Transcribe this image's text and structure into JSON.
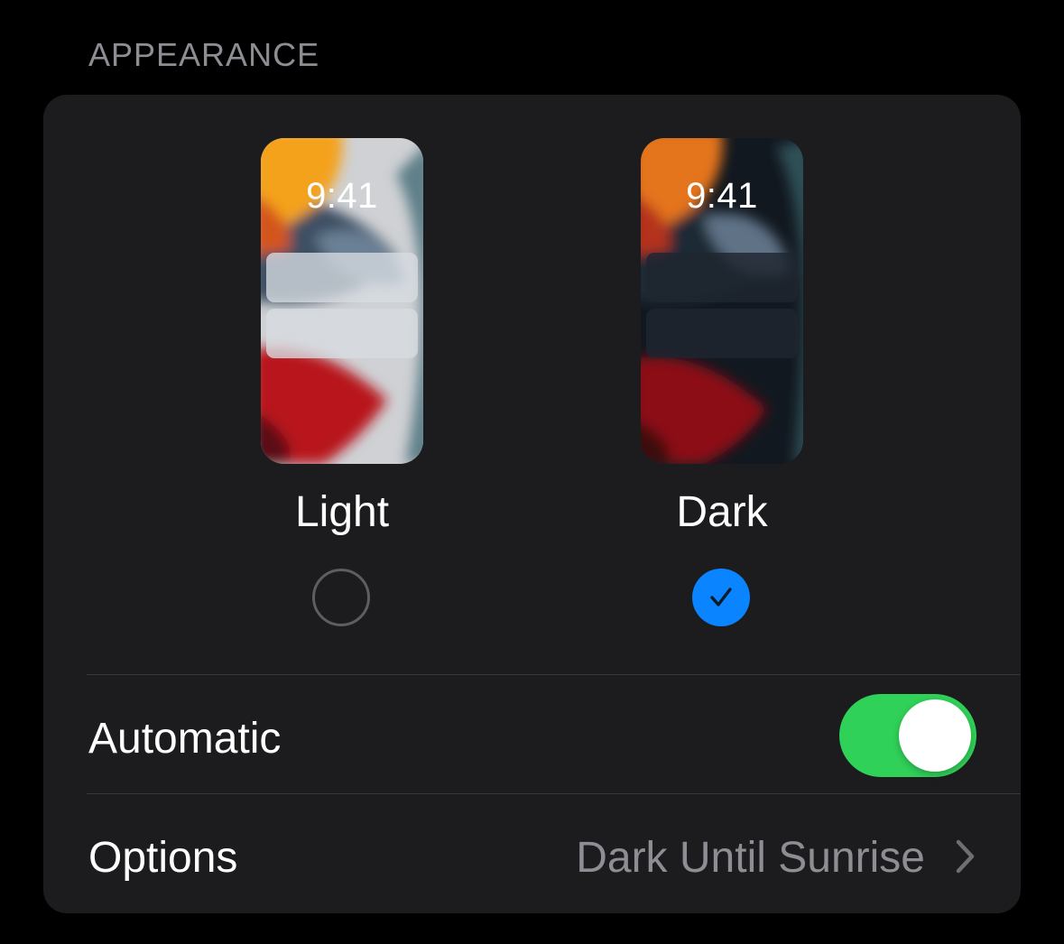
{
  "section": {
    "title": "APPEARANCE"
  },
  "modes": [
    {
      "label": "Light",
      "preview_time": "9:41",
      "selected": false
    },
    {
      "label": "Dark",
      "preview_time": "9:41",
      "selected": true
    }
  ],
  "automatic": {
    "label": "Automatic",
    "toggle_on": true
  },
  "options": {
    "label": "Options",
    "value": "Dark Until Sunrise",
    "icon": "chevron-right-icon"
  },
  "colors": {
    "background": "#000000",
    "card": "#1c1c1e",
    "accent_blue": "#0a84ff",
    "toggle_green": "#30d158",
    "secondary_text": "#8d8d93"
  }
}
